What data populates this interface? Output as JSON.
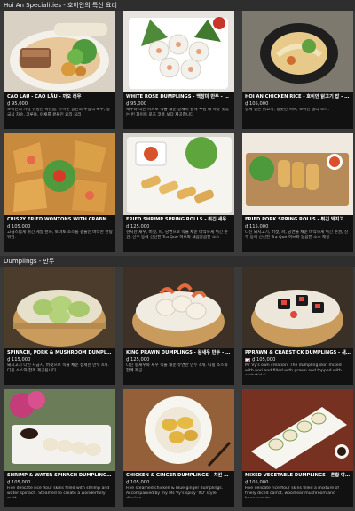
{
  "sections": [
    {
      "title": "Hoi An Specialities - 호이안의 특산 요리",
      "items": [
        {
          "name": "CAO LAU - CAO LẦU - 까오 러우",
          "price": "₫ 95,000",
          "desc": "호이안의 가장 유명한 특산품. 두꺼운 쌀면의 우동식 국수, 중국식 차슈, 크루통, 야채를 곁들인 요리 요리"
        },
        {
          "name": "WHITE ROSE DUMPLINGS - 백장미 만두 - 바인 바오 바...",
          "price": "₫ 95,000",
          "desc": "새우와 작은 파파로 속을 채운 쌀새미 덮개 투명 대 사유 맛있는 빈 화이트 로즈 코롱 보다 제공합니다"
        },
        {
          "name": "HOI AN CHICKEN RICE - 호이안 닭고기 밥 - 껌 가 호...",
          "price": "₫ 105,000",
          "desc": "잘게 찢은 닭고기, 향긋한 허브, 호이안 칠리 소스."
        },
        {
          "name": "CRISPY FRIED WONTONS WITH CRABMEAT - 게살 ...",
          "price": "₫ 105,000",
          "desc": "고급스럽게 튀긴 게살 완자, 토마토 소스를 곁들인 바삭한 완탕 튀김."
        },
        {
          "name": "FRIED SHRIMP SPRING ROLLS - 튀긴 새우 춘권 - 짜...",
          "price": "₫ 125,000",
          "desc": "현지산 새우, 버섯, 파, 당면으로 속을 채운 바삭하게 튀긴 춘권, 신주 등에 신선한 Tra Que 허브와 새콤달콤한 소스"
        },
        {
          "name": "FRIED PORK SPRING ROLLS - 튀긴 돼지고기 춘권 - ...",
          "price": "₫ 115,000",
          "desc": "다진 돼지고기, 버섯, 파, 당면을 채운 바삭하게 튀긴 춘권, 신주 등에 신선한 Tra Que 허브와 달콤한 소스 제공"
        }
      ]
    },
    {
      "title": "Dumplings - 만두",
      "items": [
        {
          "name": "SPINACH, PORK & MUSHROOM DUMPLINGS - 시금치...",
          "price": "₫ 115,000",
          "desc": "돼지고기 다진 시금치, 버섯으로 속을 채운 섬세한 만두 4개. 디핑 소스와 함께 제공됩니다.",
          "flag": false
        },
        {
          "name": "KING PRAWN DUMPLINGS - 왕새우 만두 - 하 까오 쩜...",
          "price": "₫ 125,000",
          "desc": "다진 왕새우와 새우 속을 채운 유연한 만두 4개. 디핑 소스와 함께 제공",
          "flag": false
        },
        {
          "name": "PPRAWN & CRABSTICK DUMPLINGS - 새우 & 크랩...",
          "price": "₫ 105,000",
          "desc": "Mr Vy's own creation. The dumpling skin mixed with nori and filled with prawn and topped with crabstick i...",
          "flag": true
        },
        {
          "name": "SHRIMP & WATER SPINACH DUMPLINGS - 새우와 ...",
          "price": "₫ 105,000",
          "desc": "Five delicate rice flour skins filled with shrimp and water spinach. Steamed to create a wonderfully melt ...",
          "flag": false
        },
        {
          "name": "CHICKEN & GINGER DUMPLINGS - 치킨 & 진저 만...",
          "price": "₫ 105,000",
          "desc": "Five steamed chicken & blue ginger dumplings. Accompanied by my Ms Vy's spicy 'XO' style dipping...",
          "flag": false
        },
        {
          "name": "MIXED VEGETABLE DUMPLINGS - 혼합 야채 만두 (S...",
          "price": "₫ 105,000",
          "desc": "Five delicate rice flour skins filled a mixture of finely diced carrot, wood ear mushroom and beansprouts...",
          "flag": false
        }
      ]
    }
  ]
}
